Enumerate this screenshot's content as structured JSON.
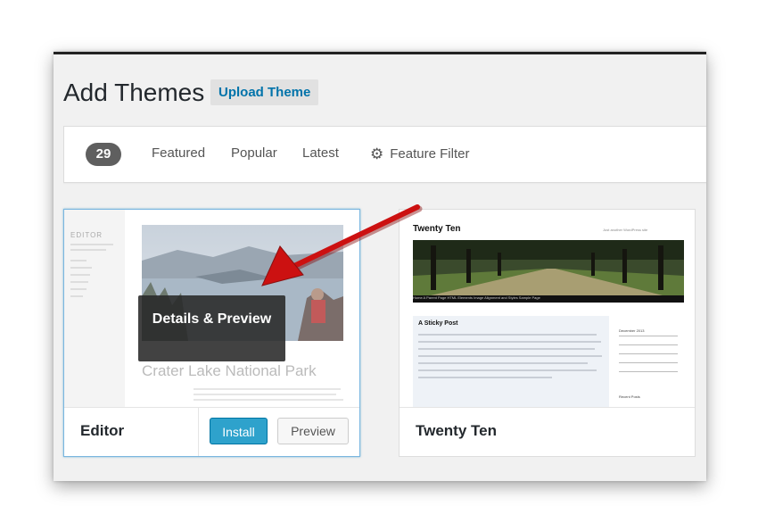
{
  "header": {
    "title": "Add Themes",
    "upload_label": "Upload Theme"
  },
  "filters": {
    "count": "29",
    "tabs": [
      "Featured",
      "Popular",
      "Latest"
    ],
    "feature_filter": "Feature Filter",
    "feature_filter_icon": "gear-icon"
  },
  "themes": [
    {
      "name": "Editor",
      "overlay": "Details & Preview",
      "install_label": "Install",
      "preview_label": "Preview",
      "screenshot": {
        "brand": "EDITOR",
        "heading": "Crater Lake National Park"
      }
    },
    {
      "name": "Twenty Ten",
      "screenshot": {
        "site_title": "Twenty Ten",
        "nav": "Home   A Parent Page   HTML Elements   Image Alignment and Styles   Sample Page",
        "post_title": "A Sticky Post",
        "calendar": "December 2013",
        "recent_posts": "Recent Posts"
      }
    }
  ],
  "annotation": {
    "arrow_color": "#cc1111"
  },
  "colors": {
    "accent": "#0073aa",
    "install": "#2ea2cc",
    "selected_border": "#7ab6e0"
  }
}
